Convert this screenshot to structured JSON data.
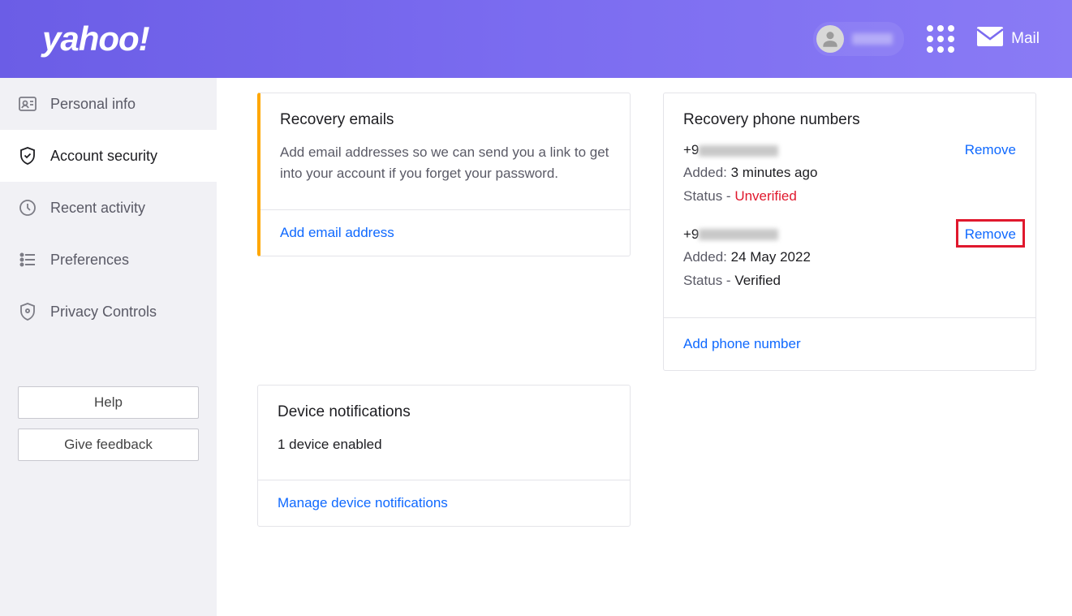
{
  "header": {
    "logo": "yahoo!",
    "mail_label": "Mail"
  },
  "sidebar": {
    "items": [
      {
        "label": "Personal info"
      },
      {
        "label": "Account security"
      },
      {
        "label": "Recent activity"
      },
      {
        "label": "Preferences"
      },
      {
        "label": "Privacy Controls"
      }
    ],
    "help_label": "Help",
    "feedback_label": "Give feedback"
  },
  "recovery_emails": {
    "title": "Recovery emails",
    "description": "Add email addresses so we can send you a link to get into your account if you forget your password.",
    "action": "Add email address"
  },
  "recovery_phones": {
    "title": "Recovery phone numbers",
    "items": [
      {
        "prefix": "+9",
        "added_label": "Added:",
        "added_value": "3 minutes ago",
        "status_label": "Status - ",
        "status_value": "Unverified",
        "status_class": "unverified",
        "remove": "Remove"
      },
      {
        "prefix": "+9",
        "added_label": "Added:",
        "added_value": "24 May 2022",
        "status_label": "Status - ",
        "status_value": "Verified",
        "status_class": "",
        "remove": "Remove"
      }
    ],
    "action": "Add phone number"
  },
  "device_notifications": {
    "title": "Device notifications",
    "summary": "1 device enabled",
    "action": "Manage device notifications"
  }
}
